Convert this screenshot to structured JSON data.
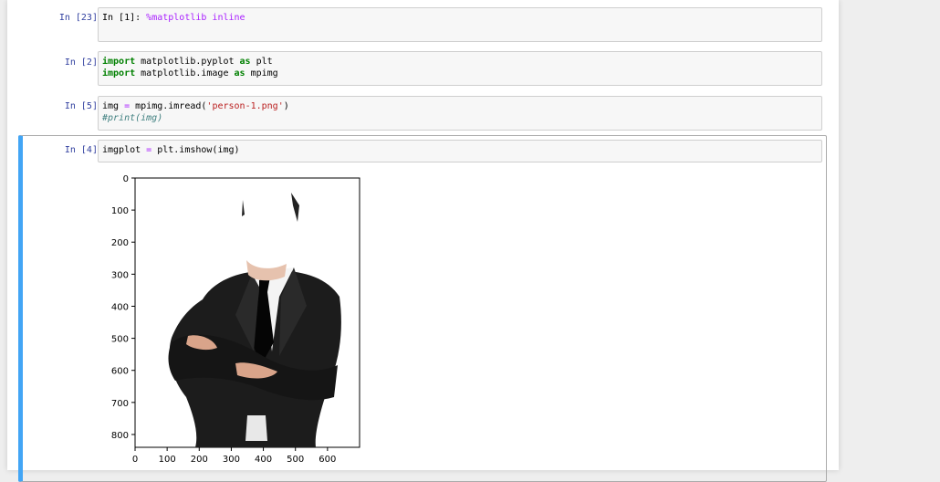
{
  "cells": [
    {
      "prompt": "In [23]:",
      "code_plain": "In [1]: ",
      "code_magic": "%matplotlib inline"
    },
    {
      "prompt": "In [2]:",
      "lines": [
        {
          "kw1": "import",
          "mid": " matplotlib.pyplot ",
          "kw2": "as",
          "tail": " plt"
        },
        {
          "kw1": "import",
          "mid": " matplotlib.image ",
          "kw2": "as",
          "tail": " mpimg"
        }
      ]
    },
    {
      "prompt": "In [5]:",
      "line1_a": "img ",
      "line1_op": "=",
      "line1_b": " mpimg.imread(",
      "line1_str": "'person-1.png'",
      "line1_c": ")",
      "line2_comment": "#print(img)"
    },
    {
      "prompt": "In [4]:",
      "a": "imgplot ",
      "op": "=",
      "b": " plt.imshow(img)"
    }
  ],
  "chart_data": {
    "type": "image",
    "image_description_name": "person-1.png",
    "x_ticks": [
      0,
      100,
      200,
      300,
      400,
      500,
      600
    ],
    "y_ticks": [
      0,
      100,
      200,
      300,
      400,
      500,
      600,
      700,
      800
    ],
    "xlim": [
      0,
      700
    ],
    "ylim": [
      840,
      0
    ]
  }
}
